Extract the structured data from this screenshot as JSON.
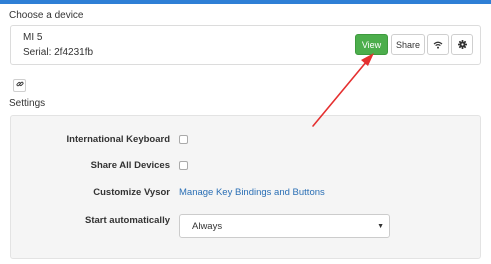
{
  "header": {
    "choose_device_label": "Choose a device"
  },
  "device": {
    "name": "MI 5",
    "serial": "Serial: 2f4231fb",
    "actions": {
      "view_label": "View",
      "share_label": "Share",
      "wifi_icon": "wifi-icon",
      "settings_icon": "gear-icon"
    }
  },
  "link_icon": "link-icon",
  "settings": {
    "title": "Settings",
    "rows": [
      {
        "label": "International Keyboard",
        "type": "checkbox",
        "checked": false
      },
      {
        "label": "Share All Devices",
        "type": "checkbox",
        "checked": false
      },
      {
        "label": "Customize Vysor",
        "type": "link",
        "link_text": "Manage Key Bindings and Buttons"
      },
      {
        "label": "Start automatically",
        "type": "select",
        "value": "Always"
      }
    ]
  },
  "colors": {
    "top_bar": "#2e7fd6",
    "view_button": "#4cae4c",
    "link": "#2a6fb5",
    "annotation_arrow": "#e53030"
  }
}
